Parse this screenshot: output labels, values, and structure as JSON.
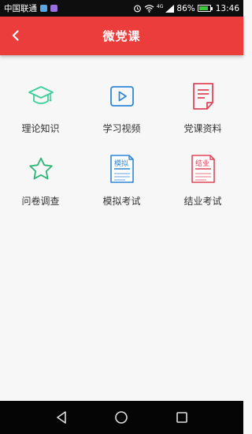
{
  "status_bar": {
    "carrier": "中国联通",
    "network": "4G",
    "battery_percent": "86%",
    "battery_level": 0.86,
    "time": "13:46",
    "icons": [
      "sim-icon",
      "app-notification-icon",
      "alarm-icon",
      "wifi-icon",
      "signal-icon",
      "battery-icon"
    ]
  },
  "header": {
    "title": "微党课",
    "back_icon": "chevron-left-icon",
    "background": "#ec3d3d"
  },
  "menu": {
    "items": [
      {
        "label": "理论知识",
        "icon": "graduation-cap-icon",
        "color": "#3fcf9a"
      },
      {
        "label": "学习视频",
        "icon": "video-play-icon",
        "color": "#2f86d6"
      },
      {
        "label": "党课资料",
        "icon": "document-icon",
        "color": "#e0475a"
      },
      {
        "label": "问卷调查",
        "icon": "star-icon",
        "color": "#2bb673"
      },
      {
        "label": "模拟考试",
        "icon": "mock-exam-icon",
        "icon_text": "模拟",
        "color": "#2f86d6"
      },
      {
        "label": "结业考试",
        "icon": "final-exam-icon",
        "icon_text": "结业",
        "color": "#e0475a"
      }
    ]
  },
  "nav_bar": {
    "icons": [
      "back-triangle-icon",
      "home-circle-icon",
      "recents-square-icon"
    ]
  }
}
